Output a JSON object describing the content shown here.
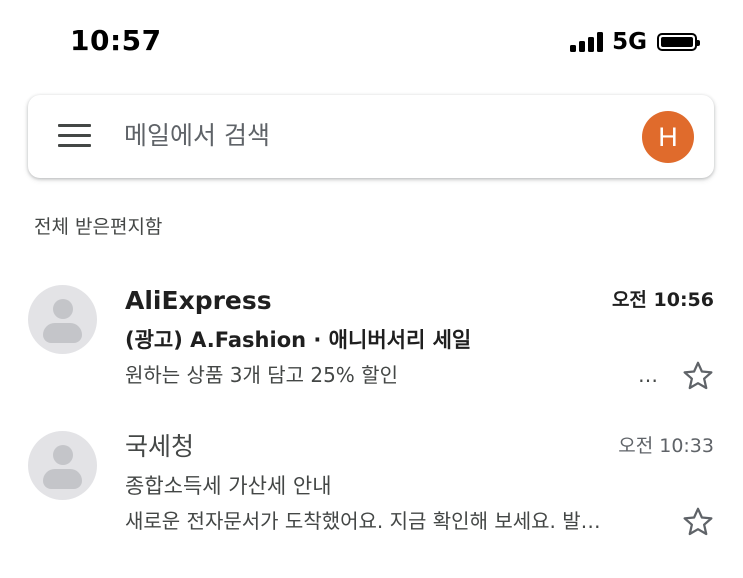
{
  "status_bar": {
    "time": "10:57",
    "network": "5G",
    "icons": [
      "signal-icon",
      "battery-icon"
    ]
  },
  "search": {
    "placeholder": "메일에서 검색",
    "menu_icon": "hamburger-menu-icon",
    "avatar_letter": "H",
    "avatar_color": "#e06b2c"
  },
  "section": {
    "label": "전체 받은편지함"
  },
  "mails": [
    {
      "sender": "AliExpress",
      "time": "오전 10:56",
      "subject": "(광고) A.Fashion · 애니버서리 세일",
      "snippet": "원하는 상품 3개 담고 25% 할인",
      "snippet_more": "…",
      "unread": true,
      "starred": false
    },
    {
      "sender": "국세청",
      "time": "오전 10:33",
      "subject": "종합소득세 가산세 안내",
      "snippet": "새로운 전자문서가 도착했어요. 지금 확인해 보세요. 발…",
      "unread": false,
      "starred": false
    }
  ],
  "colors": {
    "text_primary": "#1f1f1f",
    "text_secondary": "#444746",
    "avatar_placeholder_bg": "#e3e3e6",
    "star_outline": "#5f6368"
  }
}
